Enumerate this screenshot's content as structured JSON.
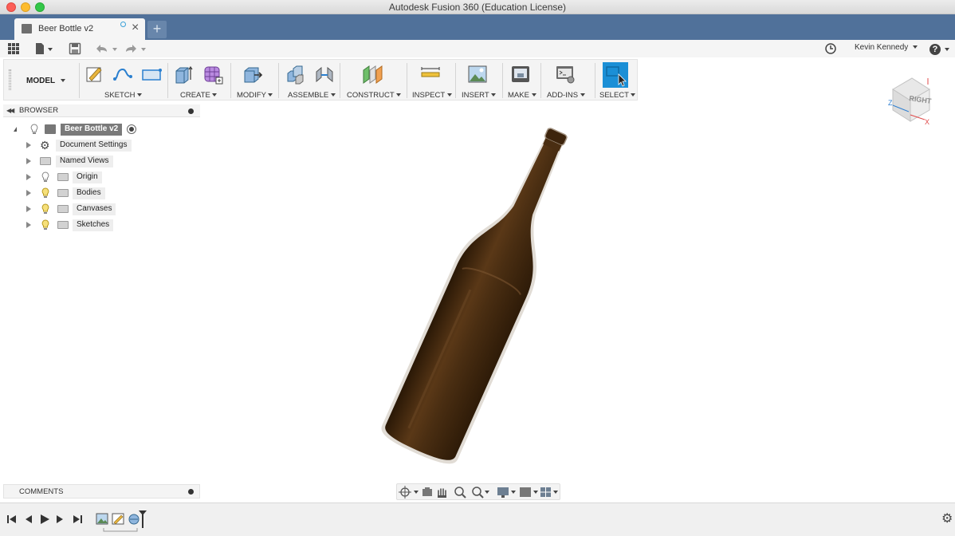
{
  "window": {
    "title": "Autodesk Fusion 360 (Education License)"
  },
  "tabs": {
    "active_document": "Beer Bottle v2",
    "new_tab_symbol": "+",
    "close_symbol": "×"
  },
  "quick_access": {
    "user": "Kevin Kennedy",
    "help_symbol": "?"
  },
  "ribbon": {
    "workspace": "MODEL",
    "groups": [
      "SKETCH",
      "CREATE",
      "MODIFY",
      "ASSEMBLE",
      "CONSTRUCT",
      "INSPECT",
      "INSERT",
      "MAKE",
      "ADD-INS",
      "SELECT"
    ],
    "select_accent": "#1b8fd6"
  },
  "browser": {
    "header": "BROWSER",
    "root": "Beer Bottle v2",
    "items": [
      "Document Settings",
      "Named Views",
      "Origin",
      "Bodies",
      "Canvases",
      "Sketches"
    ]
  },
  "comments": {
    "header": "COMMENTS"
  },
  "viewcube": {
    "face": "RIGHT",
    "axis_z": "Z",
    "axis_x": "X"
  },
  "colors": {
    "tab_bar": "#50719a",
    "bottle": "#4a2e12",
    "axis_x": "#e04a4a",
    "axis_z": "#2f7fd1",
    "bulb": "#e9c640"
  }
}
